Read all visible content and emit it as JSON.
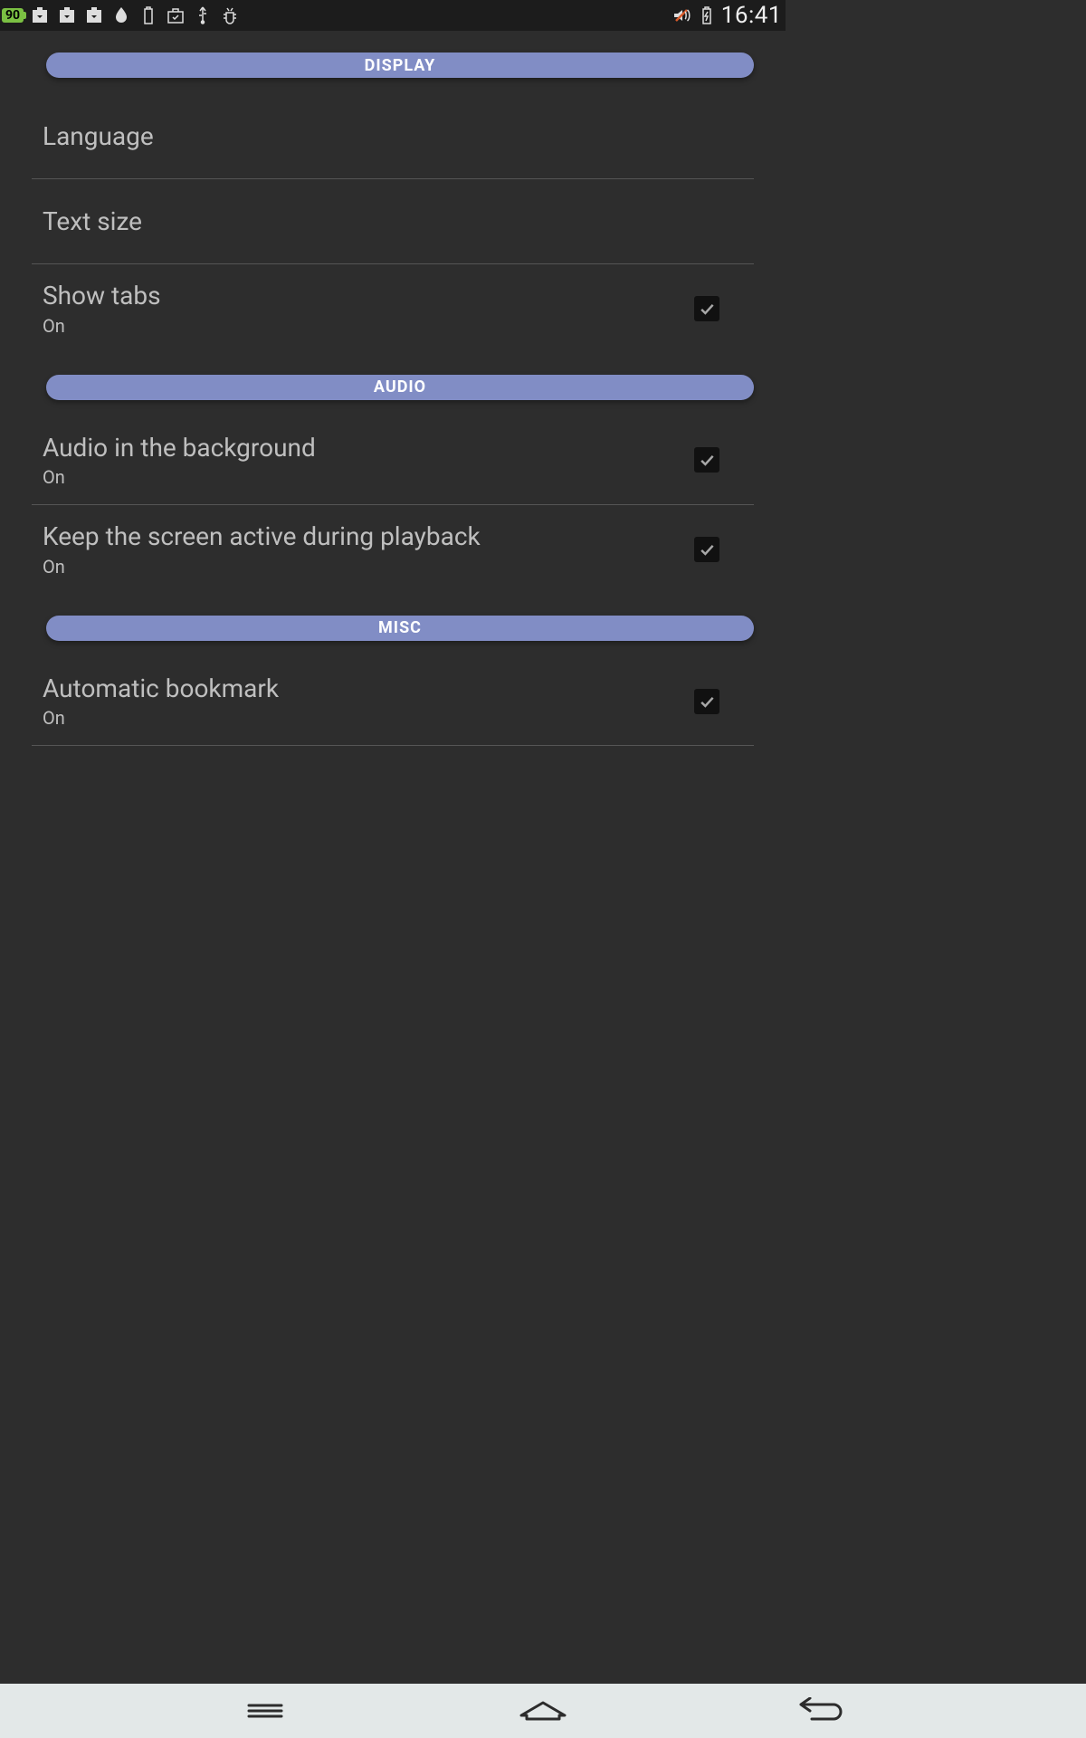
{
  "status_bar": {
    "battery_percent": "90",
    "time": "16:41"
  },
  "sections": {
    "display": {
      "header": "DISPLAY",
      "items": {
        "language": {
          "title": "Language"
        },
        "text_size": {
          "title": "Text size"
        },
        "show_tabs": {
          "title": "Show tabs",
          "sub": "On",
          "checked": true
        }
      }
    },
    "audio": {
      "header": "AUDIO",
      "items": {
        "bg_audio": {
          "title": "Audio in the background",
          "sub": "On",
          "checked": true
        },
        "screen_active": {
          "title": "Keep the screen active during playback",
          "sub": "On",
          "checked": true
        }
      }
    },
    "misc": {
      "header": "MISC",
      "items": {
        "auto_bookmark": {
          "title": "Automatic bookmark",
          "sub": "On",
          "checked": true
        }
      }
    }
  }
}
